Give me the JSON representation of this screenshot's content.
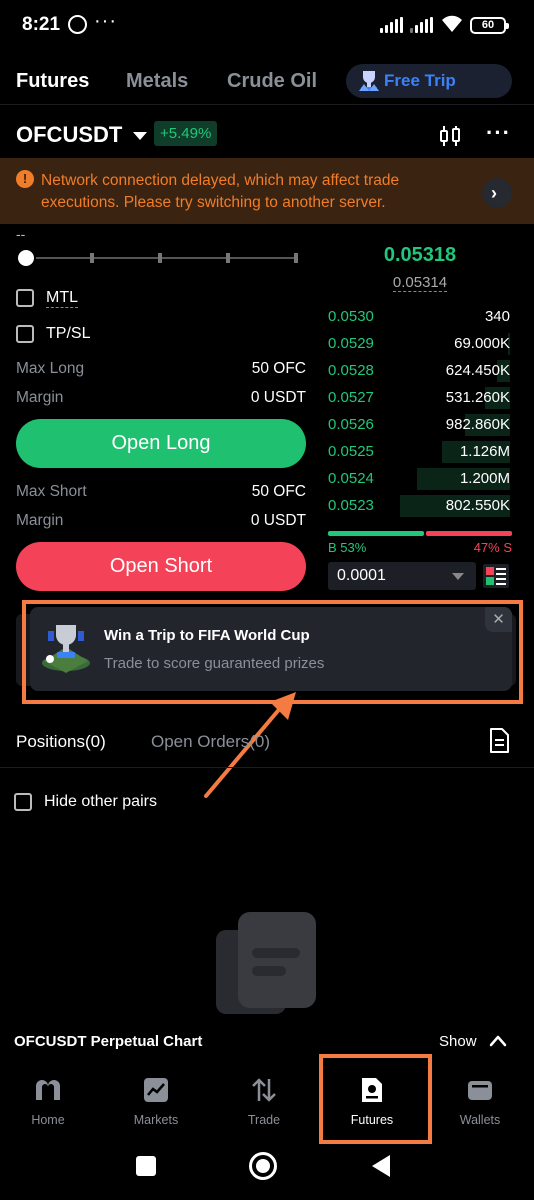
{
  "status_bar": {
    "time": "8:21",
    "overflow": "···",
    "battery": "60"
  },
  "top_tabs": {
    "items": [
      "Futures",
      "Metals",
      "Crude Oil"
    ],
    "promo_label": "Free Trip"
  },
  "pair": {
    "name": "OFCUSDT",
    "change": "+5.49%"
  },
  "warning": {
    "text": "Network connection delayed, which may affect trade executions. Please try switching to another server."
  },
  "trade": {
    "dash": "--",
    "mtl_label": "MTL",
    "tpsl_label": "TP/SL",
    "max_long_label": "Max Long",
    "max_long_value": "50 OFC",
    "margin_label": "Margin",
    "margin_long_value": "0 USDT",
    "open_long_label": "Open Long",
    "max_short_label": "Max Short",
    "max_short_value": "50 OFC",
    "margin_short_value": "0 USDT",
    "open_short_label": "Open Short"
  },
  "orderbook": {
    "last_price": "0.05318",
    "mark_price": "0.05314",
    "bids": [
      {
        "price": "0.0530",
        "qty": "340",
        "depth": 0.0
      },
      {
        "price": "0.0529",
        "qty": "69.000K",
        "depth": 0.02
      },
      {
        "price": "0.0528",
        "qty": "624.450K",
        "depth": 0.12
      },
      {
        "price": "0.0527",
        "qty": "531.260K",
        "depth": 0.22
      },
      {
        "price": "0.0526",
        "qty": "982.860K",
        "depth": 0.4
      },
      {
        "price": "0.0525",
        "qty": "1.126M",
        "depth": 0.61
      },
      {
        "price": "0.0524",
        "qty": "1.200M",
        "depth": 0.83
      },
      {
        "price": "0.0523",
        "qty": "802.550K",
        "depth": 0.98
      }
    ],
    "buy_ratio_label": "B 53%",
    "sell_ratio_label": "47% S",
    "buy_ratio": 0.53,
    "precision": "0.0001"
  },
  "promo": {
    "title": "Win a Trip to FIFA World Cup",
    "subtitle": "Trade to score guaranteed prizes",
    "close": "✕"
  },
  "positions": {
    "tabs": [
      "Positions(0)",
      "Open Orders(0)"
    ],
    "hide_other_pairs": "Hide other pairs"
  },
  "chart_bar": {
    "title": "OFCUSDT Perpetual Chart",
    "show_label": "Show"
  },
  "bottom_nav": {
    "items": [
      "Home",
      "Markets",
      "Trade",
      "Futures",
      "Wallets"
    ],
    "active": "Futures"
  },
  "colors": {
    "green": "#1fc06f",
    "red": "#f44358",
    "orange": "#f07d2a",
    "annotation": "#f47b41",
    "link": "#3b82f6"
  }
}
